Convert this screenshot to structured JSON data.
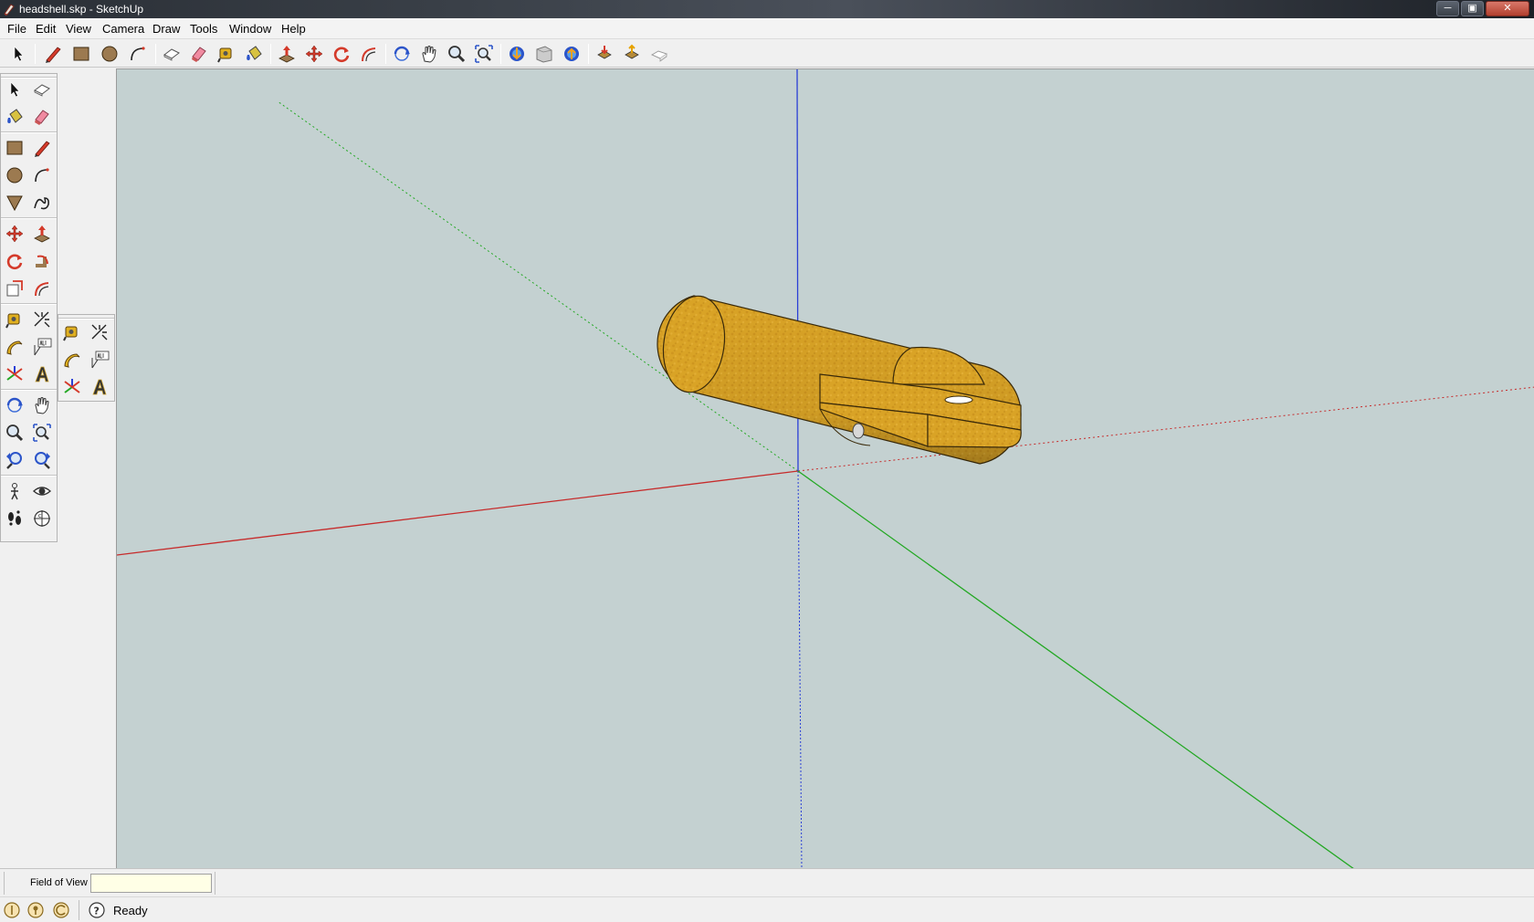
{
  "window": {
    "title": "headshell.skp - SketchUp",
    "minimize_glyph": "─",
    "restore_glyph": "▣",
    "close_glyph": "✕"
  },
  "menu": [
    "File",
    "Edit",
    "View",
    "Camera",
    "Draw",
    "Tools",
    "Window",
    "Help"
  ],
  "toolbar_icons": [
    "select-icon",
    "pencil-icon",
    "rectangle-icon",
    "circle-icon",
    "arc-icon",
    "make-component-icon",
    "eraser-icon",
    "tape-measure-icon",
    "paint-bucket-icon",
    "push-pull-icon",
    "move-icon",
    "rotate-icon",
    "offset-icon",
    "orbit-icon",
    "pan-icon",
    "zoom-icon",
    "zoom-extents-icon",
    "get-models-icon",
    "share-model-icon",
    "get-components-icon",
    "add-location-icon",
    "google-earth-icon",
    "photo-textures-icon"
  ],
  "vcb": {
    "label": "Field of View",
    "value": ""
  },
  "status": {
    "text": "Ready",
    "icons": [
      "geo-location-icon",
      "credits-icon",
      "sign-in-icon",
      "help-icon"
    ]
  },
  "colors": {
    "viewport_bg": "#c4d1d1",
    "red_axis": "#c62b2b",
    "green_axis": "#23a823",
    "blue_axis": "#2a3fd6",
    "model": "#d9a326"
  }
}
